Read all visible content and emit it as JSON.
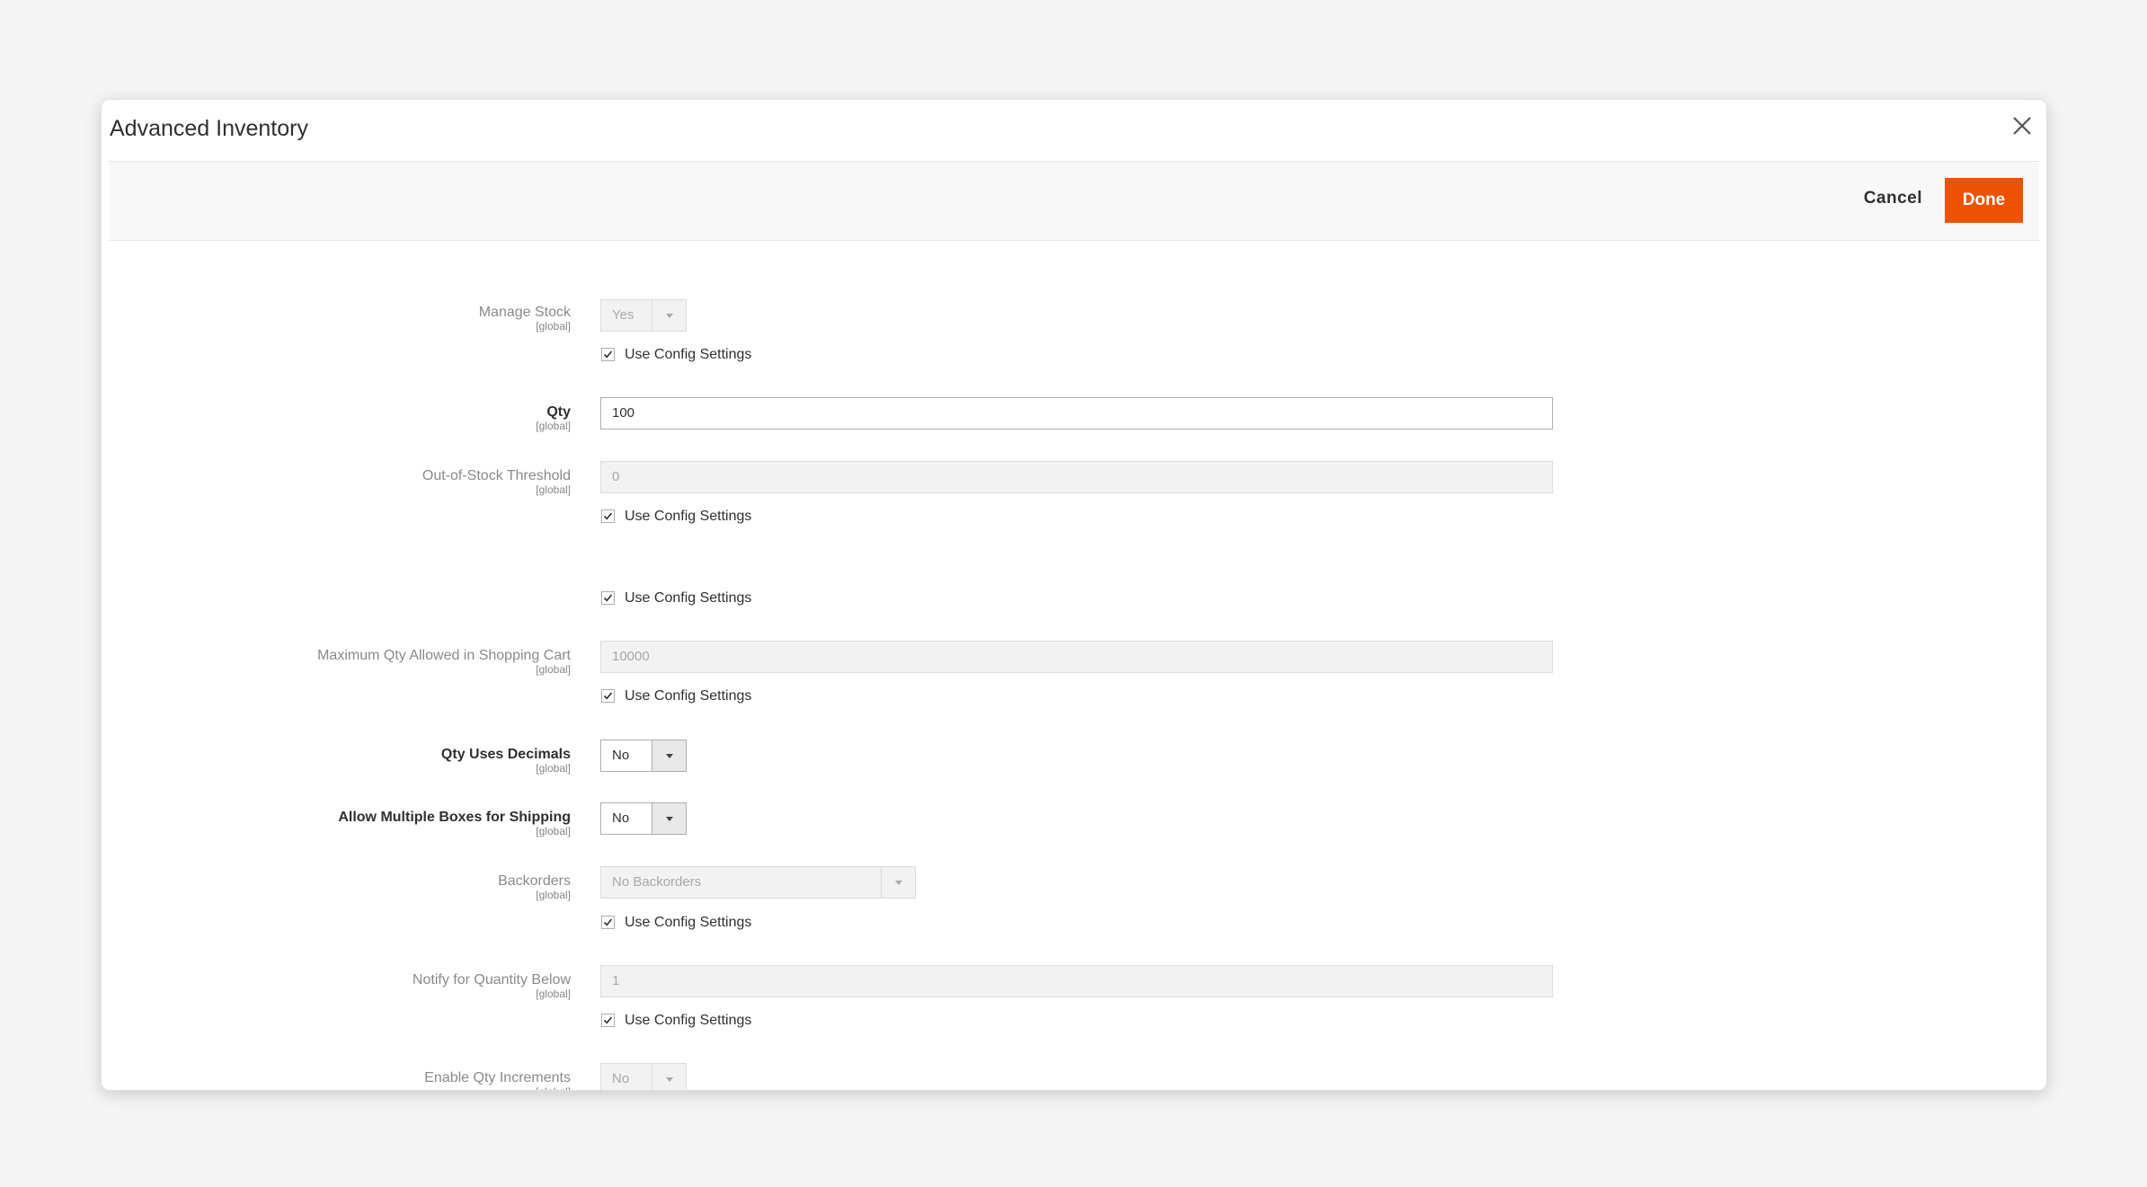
{
  "modal": {
    "title": "Advanced Inventory",
    "cancel_label": "Cancel",
    "done_label": "Done"
  },
  "scope_label": "[global]",
  "use_config_label": "Use Config Settings",
  "fields": {
    "manage_stock": {
      "label": "Manage Stock",
      "value": "Yes",
      "use_config": true
    },
    "qty": {
      "label": "Qty",
      "value": "100"
    },
    "out_of_stock_threshold": {
      "label": "Out-of-Stock Threshold",
      "value": "0",
      "use_config": true
    },
    "min_qty_use_config": true,
    "max_qty_in_cart": {
      "label": "Maximum Qty Allowed in Shopping Cart",
      "value": "10000",
      "use_config": true
    },
    "qty_uses_decimals": {
      "label": "Qty Uses Decimals",
      "value": "No"
    },
    "allow_multiple_boxes": {
      "label": "Allow Multiple Boxes for Shipping",
      "value": "No"
    },
    "backorders": {
      "label": "Backorders",
      "value": "No Backorders",
      "use_config": true
    },
    "notify_qty_below": {
      "label": "Notify for Quantity Below",
      "value": "1",
      "use_config": true
    },
    "enable_qty_increments": {
      "label": "Enable Qty Increments",
      "value": "No"
    }
  },
  "icons": {
    "close": "close-icon",
    "check": "checkmark-icon",
    "arrow": "chevron-down-icon"
  },
  "colors": {
    "primary_button": "#eb5202",
    "background": "#f5f5f5"
  }
}
